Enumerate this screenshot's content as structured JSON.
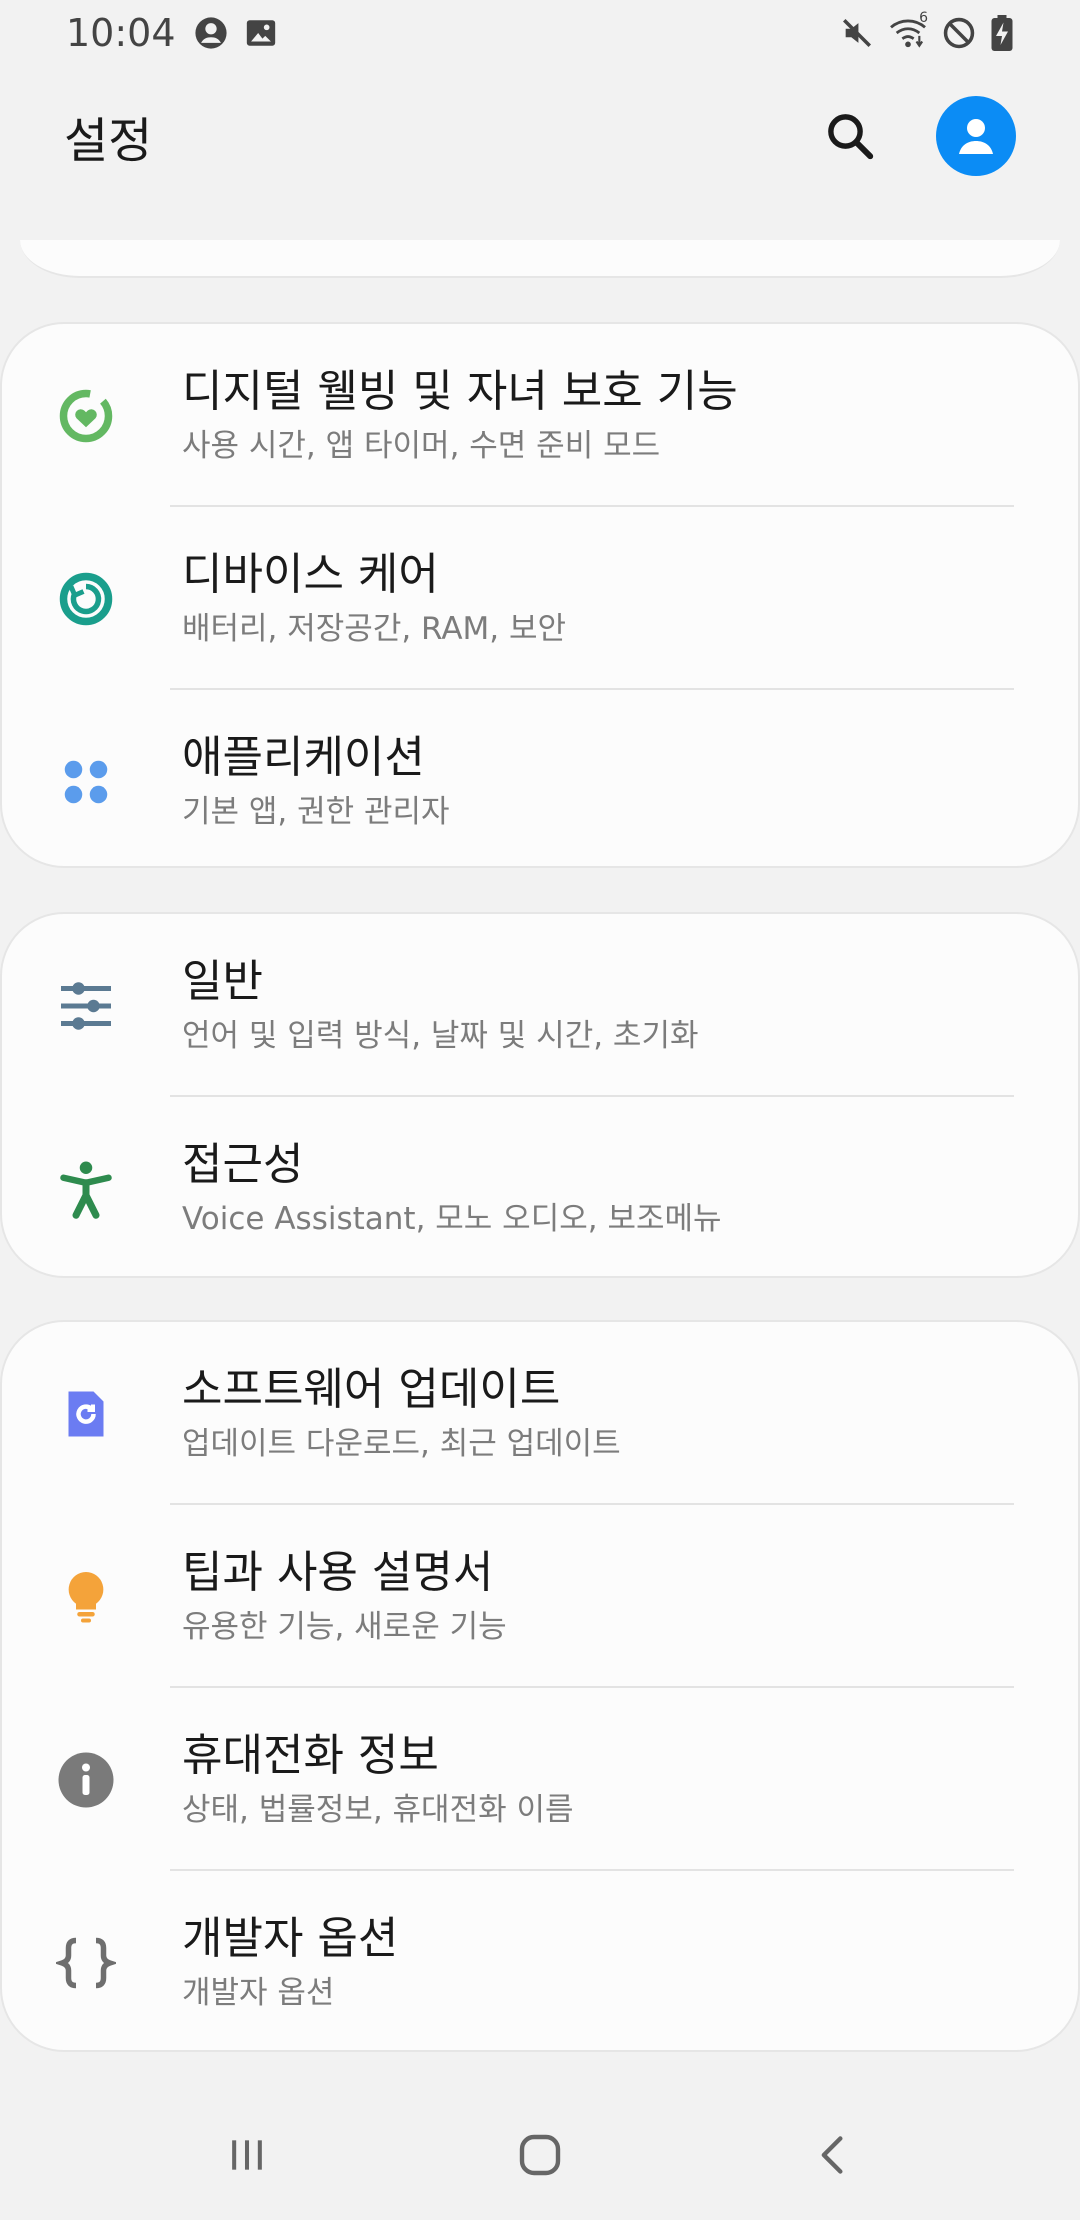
{
  "status_bar": {
    "time": "10:04",
    "left_icons": [
      "account-circle-icon",
      "image-icon"
    ],
    "right_icons": [
      "mute-icon",
      "wifi-6-icon",
      "do-not-disturb-icon",
      "battery-charging-icon"
    ],
    "wifi_badge": "6"
  },
  "app_bar": {
    "title": "설정",
    "accent_color": "#0b8cf5"
  },
  "groups": [
    {
      "items": [
        {
          "title": "디지털 웰빙 및 자녀 보호 기능",
          "subtitle": "사용 시간, 앱 타이머, 수면 준비 모드",
          "icon": "digital-wellbeing-icon",
          "color": "#63b862"
        },
        {
          "title": "디바이스 케어",
          "subtitle": "배터리, 저장공간, RAM, 보안",
          "icon": "device-care-icon",
          "color": "#1a9e8c"
        },
        {
          "title": "애플리케이션",
          "subtitle": "기본 앱, 권한 관리자",
          "icon": "apps-icon",
          "color": "#5b9cec"
        }
      ]
    },
    {
      "items": [
        {
          "title": "일반",
          "subtitle": "언어 및 입력 방식, 날짜 및 시간, 초기화",
          "icon": "general-sliders-icon",
          "color": "#5b7a92"
        },
        {
          "title": "접근성",
          "subtitle": "Voice Assistant, 모노 오디오, 보조메뉴",
          "icon": "accessibility-icon",
          "color": "#2e8b4e"
        }
      ]
    },
    {
      "items": [
        {
          "title": "소프트웨어 업데이트",
          "subtitle": "업데이트 다운로드, 최근 업데이트",
          "icon": "software-update-icon",
          "color": "#6b7cf2"
        },
        {
          "title": "팁과 사용 설명서",
          "subtitle": "유용한 기능, 새로운 기능",
          "icon": "tips-bulb-icon",
          "color": "#f4a33a"
        },
        {
          "title": "휴대전화 정보",
          "subtitle": "상태, 법률정보, 휴대전화 이름",
          "icon": "info-icon",
          "color": "#7a7a7a"
        },
        {
          "title": "개발자 옵션",
          "subtitle": "개발자 옵션",
          "icon": "developer-braces-icon",
          "color": "#6e6e6e"
        }
      ]
    }
  ],
  "nav_bar": {
    "buttons": [
      "recents-icon",
      "home-icon",
      "back-icon"
    ]
  }
}
